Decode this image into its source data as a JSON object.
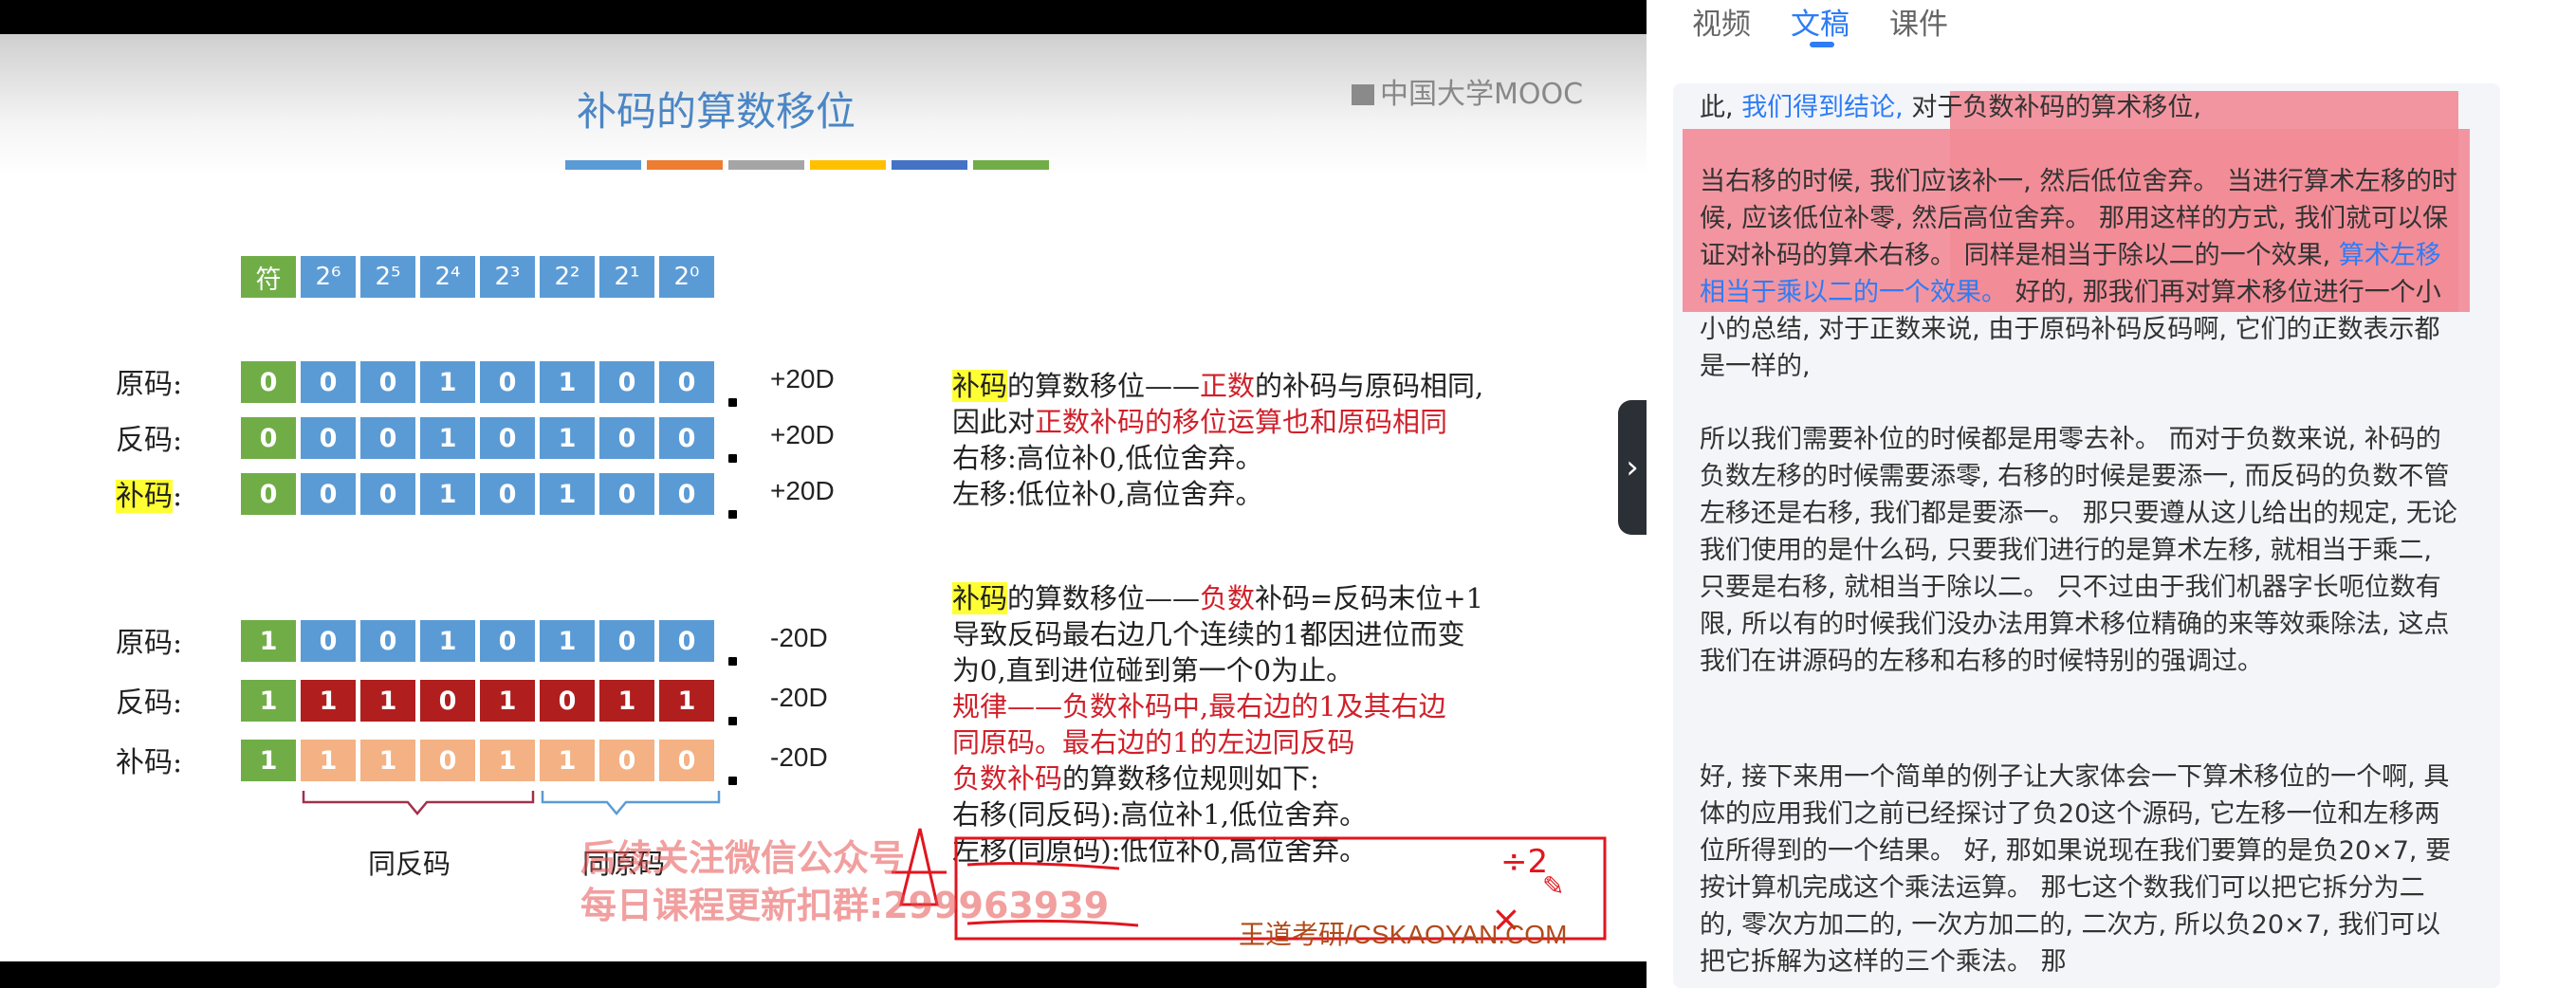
{
  "slide": {
    "title": "补码的算数移位",
    "logo": "中国大学MOOC",
    "bar_colors": [
      "#5b9bd5",
      "#ed7d31",
      "#a5a5a5",
      "#ffc000",
      "#4472c4",
      "#70ad47"
    ],
    "header_cells": [
      "符",
      "2⁶",
      "2⁵",
      "2⁴",
      "2³",
      "2²",
      "2¹",
      "2⁰"
    ],
    "positive": {
      "rows": [
        {
          "label": "原码:",
          "bits": [
            "0",
            "0",
            "0",
            "1",
            "0",
            "1",
            "0",
            "0"
          ],
          "value": "+20D"
        },
        {
          "label": "反码:",
          "bits": [
            "0",
            "0",
            "0",
            "1",
            "0",
            "1",
            "0",
            "0"
          ],
          "value": "+20D"
        },
        {
          "label": "补码:",
          "bits": [
            "0",
            "0",
            "0",
            "1",
            "0",
            "1",
            "0",
            "0"
          ],
          "value": "+20D"
        }
      ]
    },
    "negative": {
      "rows": [
        {
          "label": "原码:",
          "bits": [
            "1",
            "0",
            "0",
            "1",
            "0",
            "1",
            "0",
            "0"
          ],
          "value": "-20D"
        },
        {
          "label": "反码:",
          "bits": [
            "1",
            "1",
            "1",
            "0",
            "1",
            "0",
            "1",
            "1"
          ],
          "value": "-20D"
        },
        {
          "label": "补码:",
          "bits": [
            "1",
            "1",
            "1",
            "0",
            "1",
            "1",
            "0",
            "0"
          ],
          "value": "-20D"
        }
      ]
    },
    "pos_text": {
      "l1_a": "补码",
      "l1_b": "的算数移位——",
      "l1_c": "正数",
      "l1_d": "的补码与原码相同,",
      "l2_a": "因此对",
      "l2_b": "正数补码的移位运算也和原码相同",
      "l3": "右移:高位补0,低位舍弃。",
      "l4": "左移:低位补0,高位舍弃。"
    },
    "neg_text": {
      "l1_a": "补码",
      "l1_b": "的算数移位——",
      "l1_c": "负数",
      "l1_d": "补码=反码末位+1",
      "l2": "导致反码最右边几个连续的1都因进位而变",
      "l3": "为0,直到进位碰到第一个0为止。",
      "l4": "规律——负数补码中,最右边的1及其右边",
      "l5": "同原码。最右边的1的左边同反码",
      "l6_a": "负数补码",
      "l6_b": "的算数移位规则如下:",
      "l7": "右移(同反码):高位补1,低位舍弃。",
      "l8": "左移(同原码):低位补0,高位舍弃。"
    },
    "brace_left": "同反码",
    "brace_right": "同原码",
    "watermark_1": "后续关注微信公众号",
    "watermark_2": "每日课程更新扣群:299963939",
    "footer_logo": "王道考研/CSKAOYAN.COM"
  },
  "panel": {
    "tabs": [
      "视频",
      "文稿",
      "课件"
    ],
    "active_tab": 1,
    "p1_a": "此,",
    "p1_b": "我们得到结论,",
    "p1_c": "对于负数补码的算术移位,",
    "p2": "当右移的时候, 我们应该补一, 然后低位舍弃。 当进行算术左移的时候, 应该低位补零, 然后高位舍弃。 那用这样的方式, 我们就可以保证对补码的算术右移。 同样是相当于除以二的一个效果,",
    "p2_blue": "算术左移相当于乘以二的一个效果。",
    "p2_tail": "好的, 那我们再对算术移位进行一个小小的总结, 对于正数来说, 由于原码补码反码啊, 它们的正数表示都是一样的,",
    "p3": "所以我们需要补位的时候都是用零去补。 而对于负数来说, 补码的负数左移的时候需要添零, 右移的时候是要添一, 而反码的负数不管左移还是右移, 我们都是要添一。 那只要遵从这儿给出的规定, 无论我们使用的是什么码, 只要我们进行的是算术左移, 就相当于乘二, 只要是右移, 就相当于除以二。 只不过由于我们机器字长呃位数有限, 所以有的时候我们没办法用算术移位精确的来等效乘除法, 这点我们在讲源码的左移和右移的时候特别的强调过。",
    "p4": "好, 接下来用一个简单的例子让大家体会一下算术移位的一个啊, 具体的应用我们之前已经探讨了负20这个源码, 它左移一位和左移两位所得到的一个结果。 好, 那如果说现在我们要算的是负20×7, 要按计算机完成这个乘法运算。 那七这个数我们可以把它拆分为二的, 零次方加二的, 一次方加二的, 二次方, 所以负20×7, 我们可以把它拆解为这样的三个乘法。 那"
  }
}
